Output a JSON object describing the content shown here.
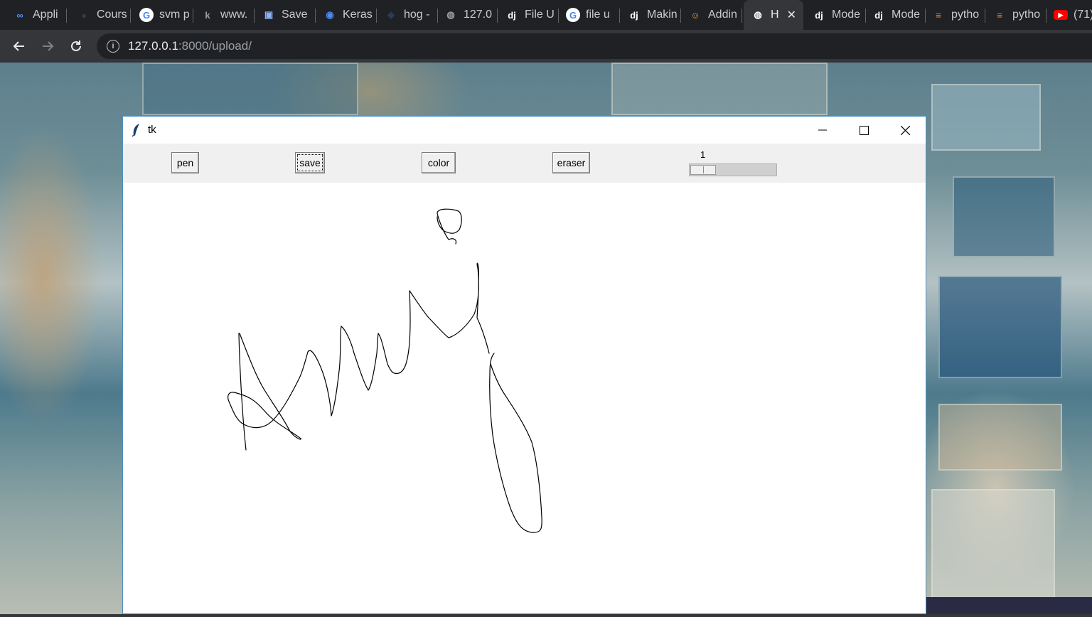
{
  "browser": {
    "tabs": [
      {
        "label": "Appli",
        "icon": "infinity-icon",
        "icon_color": "#4c8bf5"
      },
      {
        "label": "Cours",
        "icon": "github-icon",
        "icon_color": "#3a3a3a"
      },
      {
        "label": "svm p",
        "icon": "google-icon",
        "icon_color": "#ffffff"
      },
      {
        "label": "www.",
        "icon": "kaggle-icon",
        "icon_color": "#9aa0a6"
      },
      {
        "label": "Save",
        "icon": "save-disk-icon",
        "icon_color": "#8ab4f8"
      },
      {
        "label": "Keras",
        "icon": "keras-icon",
        "icon_color": "#4c8bf5"
      },
      {
        "label": "hog -",
        "icon": "hog-icon",
        "icon_color": "#2b3a55"
      },
      {
        "label": "127.0",
        "icon": "globe-icon",
        "icon_color": "#9aa0a6"
      },
      {
        "label": "File U",
        "icon": "django-icon",
        "icon_color": "#0c4b33"
      },
      {
        "label": "file u",
        "icon": "google-icon",
        "icon_color": "#ffffff"
      },
      {
        "label": "Makin",
        "icon": "django-icon",
        "icon_color": "#0c4b33"
      },
      {
        "label": "Addin",
        "icon": "avatar-icon",
        "icon_color": "#e8a13a"
      },
      {
        "label": "H",
        "icon": "globe-icon",
        "icon_color": "#ffffff",
        "active": true
      },
      {
        "label": "Mode",
        "icon": "django-icon",
        "icon_color": "#0c4b33"
      },
      {
        "label": "Mode",
        "icon": "django-icon",
        "icon_color": "#0c4b33"
      },
      {
        "label": "pytho",
        "icon": "stackoverflow-icon",
        "icon_color": "#f48024"
      },
      {
        "label": "pytho",
        "icon": "stackoverflow-icon",
        "icon_color": "#f48024"
      },
      {
        "label": "(71)",
        "icon": "youtube-icon",
        "icon_color": "#ff0000"
      }
    ],
    "django_glyph": "dj",
    "url_host": "127.0.0.1",
    "url_path": ":8000/upload/"
  },
  "tk_window": {
    "title": "tk",
    "buttons": {
      "pen": "pen",
      "save": "save",
      "color": "color",
      "eraser": "eraser"
    },
    "slider": {
      "value": "1",
      "min": 1,
      "max": 10,
      "fraction": 0.0
    }
  },
  "colors": {
    "tab_bg": "#202124",
    "toolbar_bg": "#35363a",
    "tk_bar_bg": "#f0f0f0",
    "stroke": "#000000"
  }
}
